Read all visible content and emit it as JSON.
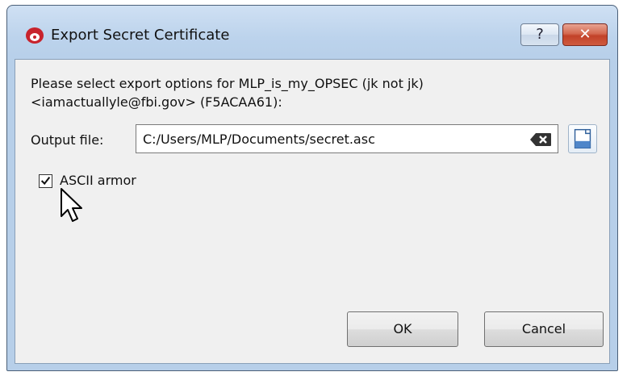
{
  "window": {
    "title": "Export Secret Certificate",
    "help_label": "?",
    "close_label": "✕"
  },
  "dialog": {
    "prompt_line1": "Please select export options for MLP_is_my_OPSEC (jk not jk)",
    "prompt_line2": "<iamactuallyle@fbi.gov> (F5ACAA61):",
    "output_label": "Output file:",
    "output_value": "C:/Users/MLP/Documents/secret.asc",
    "ascii_armor_label": "ASCII armor",
    "ascii_armor_checked": true
  },
  "buttons": {
    "ok_label": "OK",
    "cancel_label": "Cancel"
  },
  "icons": {
    "app": "kleopatra-app-icon",
    "clear": "clear-input-icon",
    "browse": "browse-file-icon",
    "cursor": "mouse-pointer-icon"
  },
  "colors": {
    "close_button": "#c24229",
    "titlebar": "#bcd3ec",
    "client_background": "#f0f0f0"
  }
}
